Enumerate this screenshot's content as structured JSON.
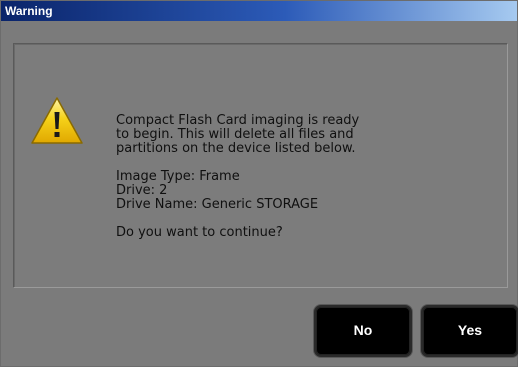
{
  "window": {
    "title": "Warning"
  },
  "dialog": {
    "icon": "warning-triangle-icon",
    "message_lines": [
      "Compact Flash Card imaging is ready",
      "to begin. This will delete all files and",
      "partitions on the device listed below."
    ],
    "details": [
      "Image Type: Frame",
      "Drive: 2",
      "Drive Name: Generic STORAGE"
    ],
    "question": "Do you want to continue?"
  },
  "buttons": {
    "no_label": "No",
    "yes_label": "Yes"
  },
  "colors": {
    "title_gradient_start": "#0a246a",
    "title_gradient_end": "#a6caf0",
    "window_bg": "#7b7b7b",
    "button_bg": "#000000",
    "warning_yellow": "#f2c200"
  }
}
